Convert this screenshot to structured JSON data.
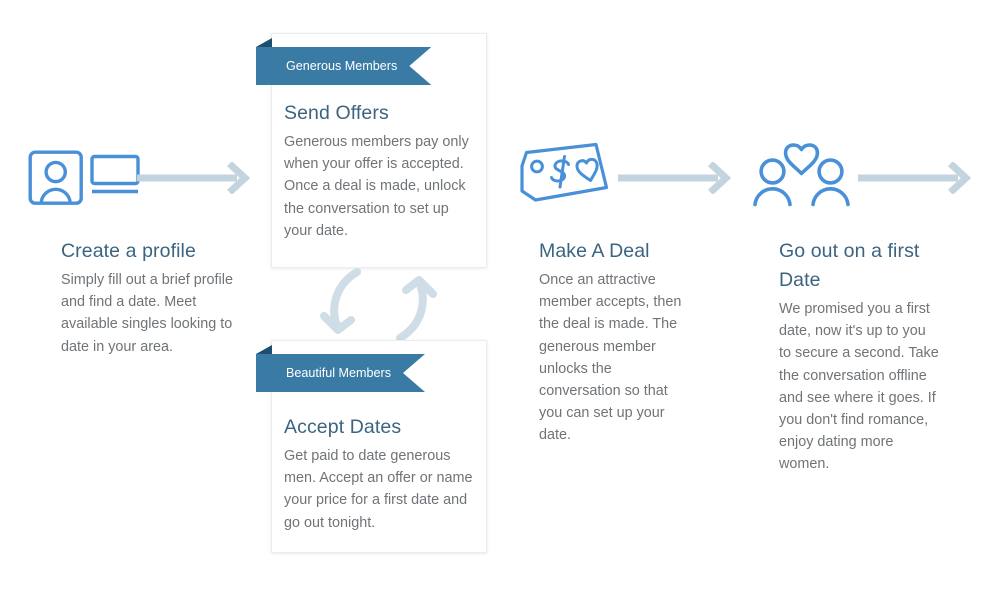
{
  "colors": {
    "icon_blue": "#4a90d9",
    "ribbon_blue": "#3a7ba6",
    "ribbon_fold": "#1d4f6e",
    "arrow_gray": "#c3d4de",
    "cycle_arrow": "#cfdde7",
    "heading": "#3c6480",
    "body_text": "#6f7478",
    "card_border": "#ebedee",
    "background": "#ffffff"
  },
  "steps": {
    "create_profile": {
      "icon": "profile-card-icon",
      "title": "Create a profile",
      "body": "Simply fill out a brief profile and find a date. Meet available singles looking to date in your area."
    },
    "make_a_deal": {
      "icon": "price-tag-heart-icon",
      "title": "Make A Deal",
      "body": "Once an attractive member accepts, then the deal is made. The generous member unlocks the conversation so that you can set up your date."
    },
    "first_date": {
      "icon": "couple-heart-icon",
      "title": "Go out on a first Date",
      "body": "We promised you a first date, now it's up to you to secure a second. Take the conversation offline and see where it goes. If you don't find romance, enjoy dating more women."
    }
  },
  "cards": {
    "send_offers": {
      "ribbon": "Generous Members",
      "title": "Send Offers",
      "body": "Generous members pay only when your offer is accepted. Once a deal is made, unlock the conversation to set up your date."
    },
    "accept_dates": {
      "ribbon": "Beautiful Members",
      "title": "Accept Dates",
      "body": "Get paid to date generous men. Accept an offer or name your price for a first date and go out tonight."
    }
  },
  "connectors": {
    "arrow_1": "arrow-right-icon",
    "arrow_2": "arrow-right-icon",
    "arrow_3": "arrow-right-icon",
    "cycle": "cycle-arrows-icon"
  }
}
